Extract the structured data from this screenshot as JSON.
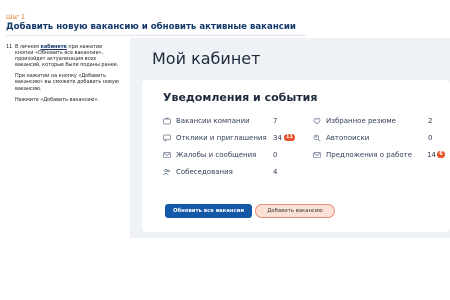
{
  "header": {
    "step": "Шаг  2",
    "title": "Добавить новую вакансию и обновить активные вакансии"
  },
  "instructions": {
    "number": "11",
    "p1_before": "В личном ",
    "p1_link": "кабинете",
    "p1_after": " при нажатии кнопки «Обновить все вакансии», произойдет актуализация всех вакансий, которые были поданы ранее.",
    "p2": "При нажатии на кнопку «Добавить вакансию» вы сможете добавить новую вакансию.",
    "p3": "Нажмите «Добавить вакансию»."
  },
  "cabinet": {
    "title": "Мой кабинет",
    "section_title": "Уведомления и события",
    "stats": [
      {
        "label": "Вакансии компании",
        "value": "7",
        "icon": "briefcase-icon"
      },
      {
        "label": "Отклики и приглашения",
        "value": "34",
        "badge": "11",
        "icon": "chat-icon"
      },
      {
        "label": "Жалобы и сообщения",
        "value": "0",
        "icon": "envelope-icon"
      },
      {
        "label": "Собеседования",
        "value": "4",
        "icon": "people-icon"
      },
      {
        "label": "Избранное резюме",
        "value": "2",
        "icon": "heart-icon"
      },
      {
        "label": "Автопоиски",
        "value": "0",
        "icon": "search-person-icon"
      },
      {
        "label": "Предложения о работе",
        "value": "14",
        "badge": "6",
        "icon": "envelope-icon"
      }
    ],
    "update_button": "Обновить все вакансии",
    "add_button": "Добавить вакансию"
  },
  "colors": {
    "accent": "#e07a1f",
    "brand": "#14386a",
    "primary_button": "#1458a8",
    "badge": "#e5532d",
    "highlight": "#fbe0d6"
  }
}
